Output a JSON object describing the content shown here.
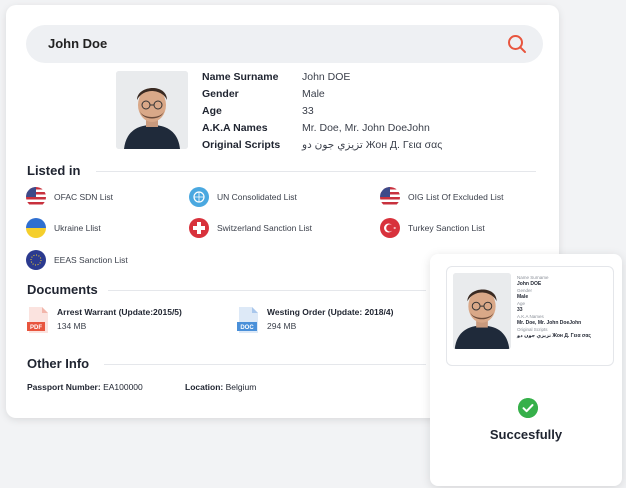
{
  "search": {
    "value": "John Doe"
  },
  "profile": {
    "fields": [
      {
        "label": "Name Surname",
        "value": "John DOE"
      },
      {
        "label": "Gender",
        "value": "Male"
      },
      {
        "label": "Age",
        "value": "33"
      },
      {
        "label": "A.K.A Names",
        "value": "Mr. Doe, Mr. John DoeJohn"
      },
      {
        "label": "Original Scripts",
        "value": "تزيزي جون دو Жон Д. Γεια σας"
      }
    ]
  },
  "listed_in": {
    "title": "Listed in",
    "items": [
      {
        "label": "OFAC SDN List",
        "icon": "us-flag-icon"
      },
      {
        "label": "UN Consolidated List",
        "icon": "un-flag-icon"
      },
      {
        "label": "OIG List Of Excluded List",
        "icon": "us-flag-icon"
      },
      {
        "label": "Ukraine Llist",
        "icon": "ukraine-flag-icon"
      },
      {
        "label": "Switzerland Sanction List",
        "icon": "switzerland-flag-icon"
      },
      {
        "label": "Turkey Sanction List",
        "icon": "turkey-flag-icon"
      },
      {
        "label": "EEAS Sanction List",
        "icon": "eu-flag-icon"
      }
    ]
  },
  "documents": {
    "title": "Documents",
    "items": [
      {
        "title": "Arrest Warrant (Update:2015/5)",
        "size": "134 MB",
        "type": "PDF",
        "color": "#e8553e"
      },
      {
        "title": "Westing Order (Update: 2018/4)",
        "size": "294 MB",
        "type": "DOC",
        "color": "#4a90d9"
      }
    ]
  },
  "other_info": {
    "title": "Other Info",
    "passport_label": "Passport Number:",
    "passport_value": "EA100000",
    "location_label": "Location:",
    "location_value": "Belgium"
  },
  "popup": {
    "fields": [
      {
        "label": "Name Surname",
        "value": "John DOE"
      },
      {
        "label": "Gender",
        "value": "Male"
      },
      {
        "label": "Age",
        "value": "33"
      },
      {
        "label": "A.K.A Names",
        "value": "Mr. Doe, Mr. John DoeJohn"
      },
      {
        "label": "Original Scripts",
        "value": "تزيزي جون دو Жон Д. Γεια σας"
      }
    ],
    "status": "Succesfully"
  },
  "colors": {
    "accent": "#e8553e",
    "success": "#36b04a"
  }
}
